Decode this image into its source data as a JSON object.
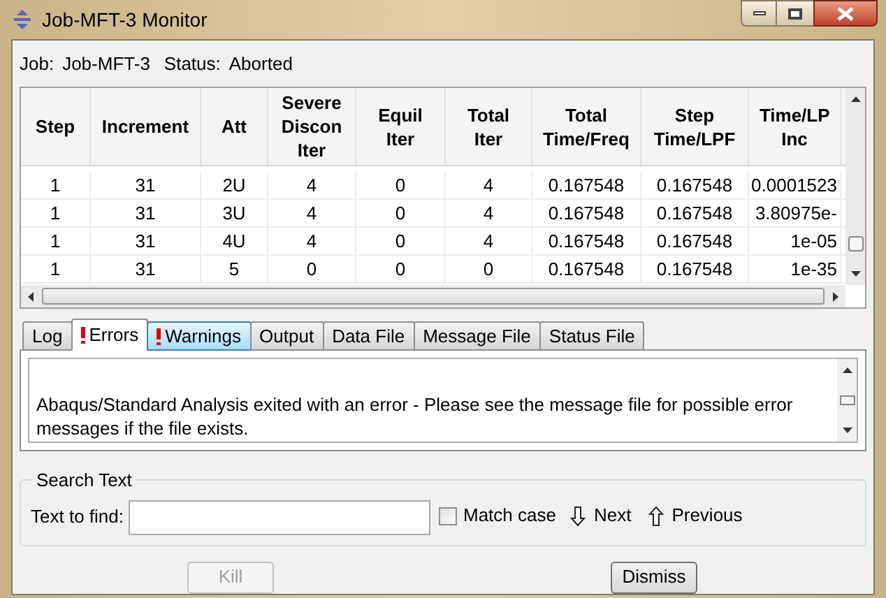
{
  "window": {
    "title": "Job-MFT-3 Monitor"
  },
  "job": {
    "job_label": "Job:",
    "job_value": "Job-MFT-3",
    "status_label": "Status:",
    "status_value": "Aborted"
  },
  "table": {
    "columns": [
      "Step",
      "Increment",
      "Att",
      "Severe Discon Iter",
      "Equil Iter",
      "Total Iter",
      "Total Time/Freq",
      "Step Time/LPF",
      "Time/LP Inc"
    ],
    "rows": [
      [
        "1",
        "31",
        "2U",
        "4",
        "0",
        "4",
        "0.167548",
        "0.167548",
        "0.0001523"
      ],
      [
        "1",
        "31",
        "3U",
        "4",
        "0",
        "4",
        "0.167548",
        "0.167548",
        "3.80975e-"
      ],
      [
        "1",
        "31",
        "4U",
        "4",
        "0",
        "4",
        "0.167548",
        "0.167548",
        "1e-05"
      ],
      [
        "1",
        "31",
        "5",
        "0",
        "0",
        "0",
        "0.167548",
        "0.167548",
        "1e-35"
      ]
    ]
  },
  "tabs": [
    {
      "label": "Log",
      "selected": false,
      "alert": false,
      "hovered": false
    },
    {
      "label": "Errors",
      "selected": true,
      "alert": true,
      "hovered": false
    },
    {
      "label": "Warnings",
      "selected": false,
      "alert": true,
      "hovered": true
    },
    {
      "label": "Output",
      "selected": false,
      "alert": false,
      "hovered": false
    },
    {
      "label": "Data File",
      "selected": false,
      "alert": false,
      "hovered": false
    },
    {
      "label": "Message File",
      "selected": false,
      "alert": false,
      "hovered": false
    },
    {
      "label": "Status File",
      "selected": false,
      "alert": false,
      "hovered": false
    }
  ],
  "message": "Abaqus/Standard Analysis exited with an error - Please see the  message file for possible error messages if the file exists.",
  "search": {
    "title": "Search Text",
    "label": "Text to find:",
    "match_case": {
      "label": "Match case",
      "checked": false
    },
    "next": "Next",
    "previous": "Previous"
  },
  "buttons": [
    {
      "label": "Kill",
      "disabled": true
    },
    {
      "label": "Dismiss",
      "disabled": false
    }
  ]
}
